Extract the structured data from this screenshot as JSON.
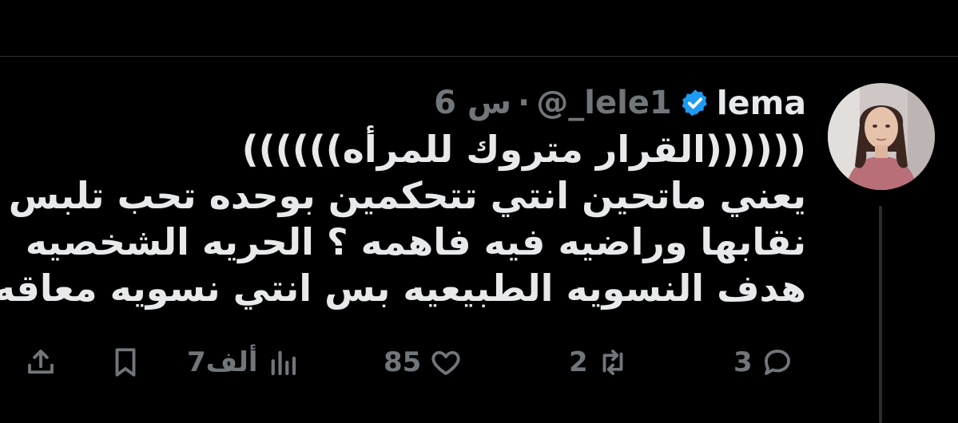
{
  "tweet": {
    "author": {
      "display_name": "lema",
      "handle": "@_lele1",
      "verified": true,
      "avatar_icon": "profile-photo"
    },
    "separator": "·",
    "time": "6 س",
    "lines": [
      "((((((القرار متروك للمرأه))))))",
      "يعني ماتحين انتي تتحكمين بوحده تحب تلبس",
      "نقابها وراضيه فيه فاهمه ؟ الحريه الشخصيه",
      "هدف النسويه الطبيعيه بس انتي نسويه معاقه"
    ],
    "actions": {
      "replies": "3",
      "retweets": "2",
      "likes": "85",
      "views": "7ألف"
    }
  },
  "colors": {
    "background": "#000000",
    "text_primary": "#e7e9ea",
    "text_secondary": "#71767b",
    "verified_badge": "#1d9bf0",
    "divider": "#2f3336"
  }
}
